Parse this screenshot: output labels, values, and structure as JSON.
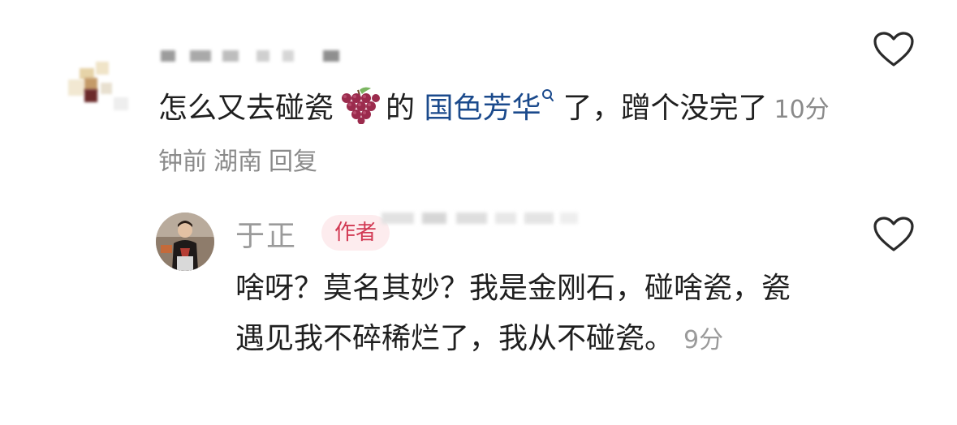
{
  "comment": {
    "text_before": "怎么又去碰瓷",
    "emoji": "grapes",
    "text_mid": "的 ",
    "link_text": "国色芳华",
    "link_icon": "search-icon",
    "text_after": "了，蹭个没完了",
    "time": "10分钟前",
    "location": "湖南",
    "reply_label": "回复"
  },
  "reply": {
    "author": "于正",
    "badge": "作者",
    "text": "啥呀？莫名其妙？我是金刚石，碰啥瓷，瓷遇见我不碎稀烂了，我从不碰瓷。",
    "time_partial": "9分"
  },
  "colors": {
    "link": "#1b4a8c",
    "badge_bg": "#fdecee",
    "badge_text": "#d23a54",
    "meta_gray": "#8a8a8a"
  }
}
